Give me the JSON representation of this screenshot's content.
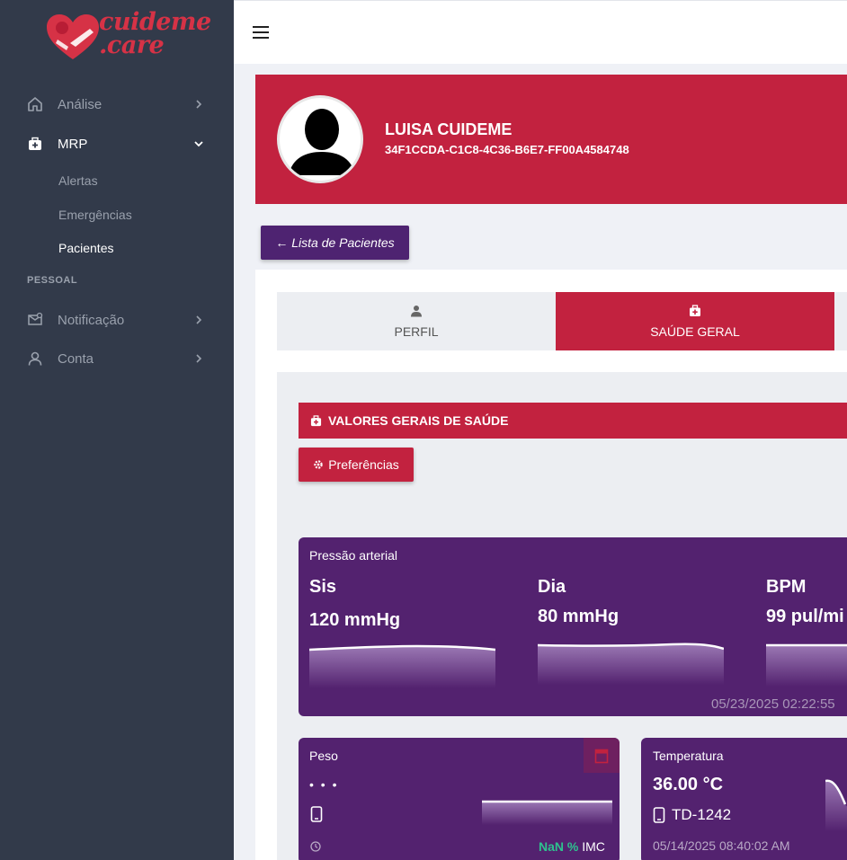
{
  "brand": {
    "line1": "cuideme",
    "line2": ".care",
    "color": "#d63246"
  },
  "sidebar": {
    "items": [
      {
        "label": "Análise",
        "icon": "home-icon"
      },
      {
        "label": "MRP",
        "icon": "medkit-icon"
      },
      {
        "label": "Notificação",
        "icon": "mail-check-icon"
      },
      {
        "label": "Conta",
        "icon": "user-icon"
      }
    ],
    "mrp_sub": [
      "Alertas",
      "Emergências",
      "Pacientes"
    ],
    "section_pessoal": "PESSOAL"
  },
  "patient": {
    "name": "LUISA CUIDEME",
    "id": "34F1CCDA-C1C8-4C36-B6E7-FF00A4584748"
  },
  "back_button": "← Lista de Pacientes",
  "tabs": [
    {
      "label": "PERFIL",
      "icon": "user-icon"
    },
    {
      "label": "SAÚDE GERAL",
      "icon": "medkit-icon"
    }
  ],
  "section": {
    "title": "VALORES GERAIS DE SAÚDE",
    "preferences_button": "Preferências"
  },
  "blood_pressure": {
    "title": "Pressão arterial",
    "sis_label": "Sis",
    "sis_value": "120 mmHg",
    "dia_label": "Dia",
    "dia_value": "80 mmHg",
    "bpm_label": "BPM",
    "bpm_value": "99 pul/mi",
    "date": "05/23/2025 02:22:55"
  },
  "weight": {
    "title": "Peso",
    "dots": "• • •",
    "imc_pct": "NaN %",
    "imc_label": "IMC"
  },
  "temperature": {
    "title": "Temperatura",
    "value": "36.00 °C",
    "device": "TD-1242",
    "date": "05/14/2025 08:40:02 AM"
  },
  "colors": {
    "primary_red": "#c2223f",
    "purple_card": "#53226f",
    "sidebar_bg": "#323a4a",
    "imc_green": "#2ec28e"
  }
}
